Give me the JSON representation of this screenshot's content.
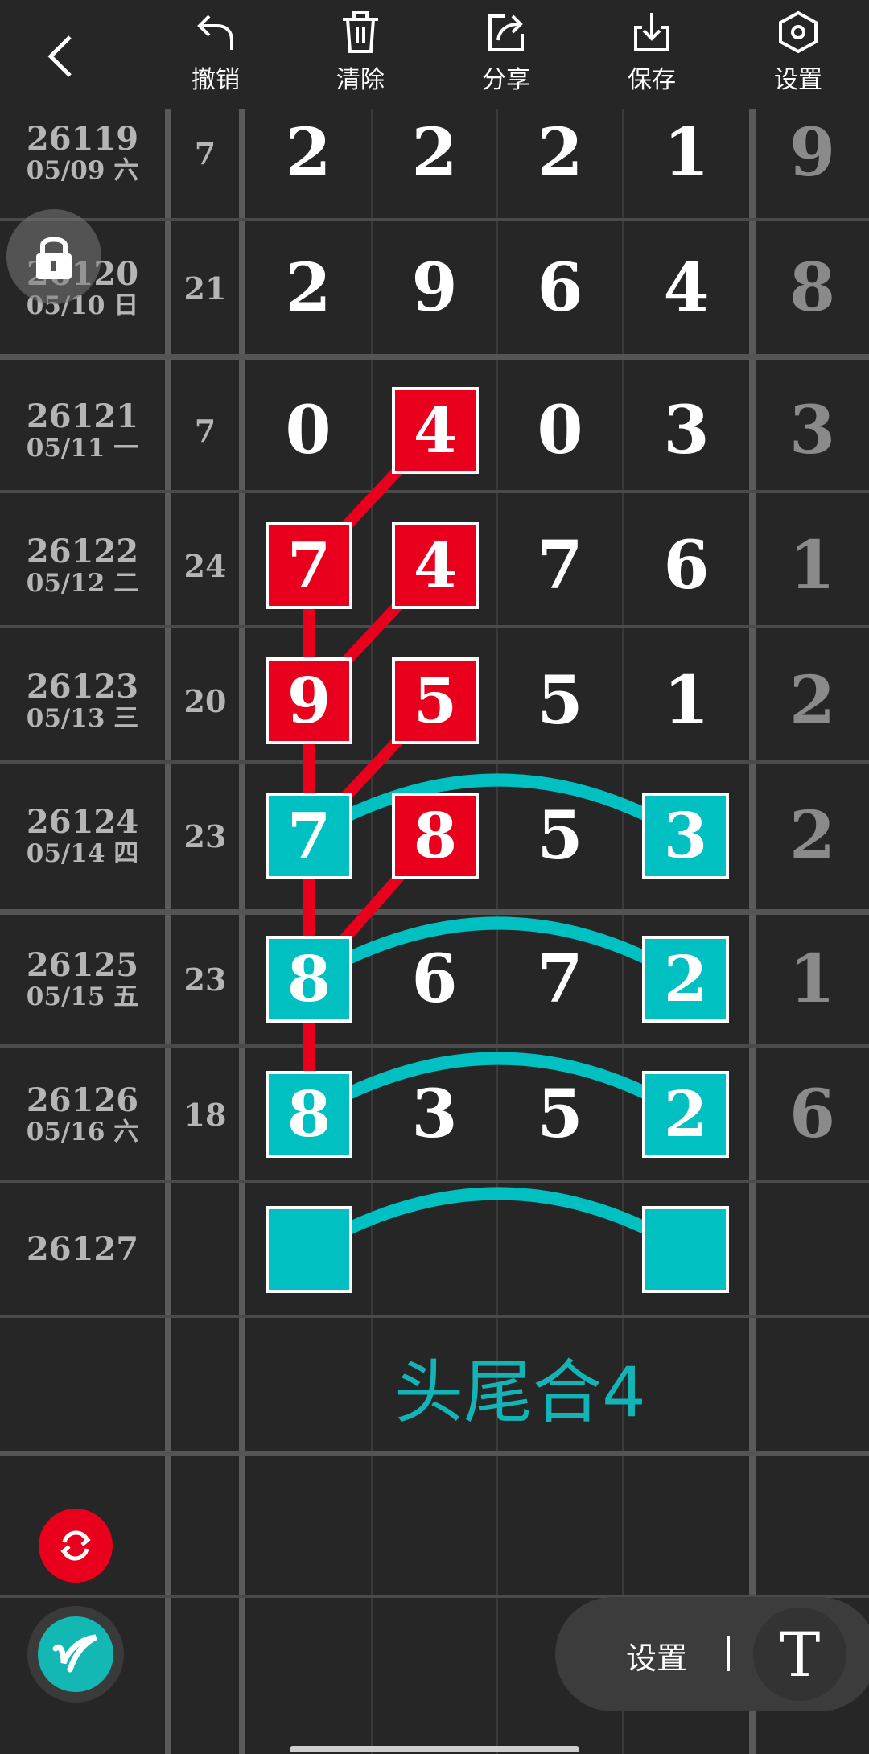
{
  "toolbar": {
    "back_label": "",
    "buttons": [
      {
        "key": "undo",
        "label": "撤销",
        "icon": "undo-icon"
      },
      {
        "key": "clear",
        "label": "清除",
        "icon": "trash-icon"
      },
      {
        "key": "share",
        "label": "分享",
        "icon": "share-icon"
      },
      {
        "key": "save",
        "label": "保存",
        "icon": "download-icon"
      },
      {
        "key": "settings",
        "label": "设置",
        "icon": "settings-hex-icon"
      }
    ]
  },
  "rows": [
    {
      "issue": "26119",
      "date": "05/09 六",
      "sum": "7",
      "digits": [
        "2",
        "2",
        "2",
        "1"
      ],
      "tail": "9"
    },
    {
      "issue": "26120",
      "date": "05/10 日",
      "sum": "21",
      "digits": [
        "2",
        "9",
        "6",
        "4"
      ],
      "tail": "8"
    },
    {
      "issue": "26121",
      "date": "05/11 一",
      "sum": "7",
      "digits": [
        "0",
        "4",
        "0",
        "3"
      ],
      "tail": "3"
    },
    {
      "issue": "26122",
      "date": "05/12 二",
      "sum": "24",
      "digits": [
        "7",
        "4",
        "7",
        "6"
      ],
      "tail": "1"
    },
    {
      "issue": "26123",
      "date": "05/13 三",
      "sum": "20",
      "digits": [
        "9",
        "5",
        "5",
        "1"
      ],
      "tail": "2"
    },
    {
      "issue": "26124",
      "date": "05/14 四",
      "sum": "23",
      "digits": [
        "7",
        "8",
        "5",
        "3"
      ],
      "tail": "2"
    },
    {
      "issue": "26125",
      "date": "05/15 五",
      "sum": "23",
      "digits": [
        "8",
        "6",
        "7",
        "2"
      ],
      "tail": "1"
    },
    {
      "issue": "26126",
      "date": "05/16 六",
      "sum": "18",
      "digits": [
        "8",
        "3",
        "5",
        "2"
      ],
      "tail": "6"
    },
    {
      "issue": "26127",
      "date": "",
      "sum": "",
      "digits": [
        "",
        "",
        "",
        ""
      ],
      "tail": ""
    }
  ],
  "annotation": "头尾合4",
  "bottom_bar": {
    "settings_label": "设置",
    "text_tool_glyph": "T"
  },
  "colors": {
    "background": "#262626",
    "red_mark": "#e8001c",
    "teal_mark": "#00c0c2",
    "annotation": "#13b4b6"
  }
}
